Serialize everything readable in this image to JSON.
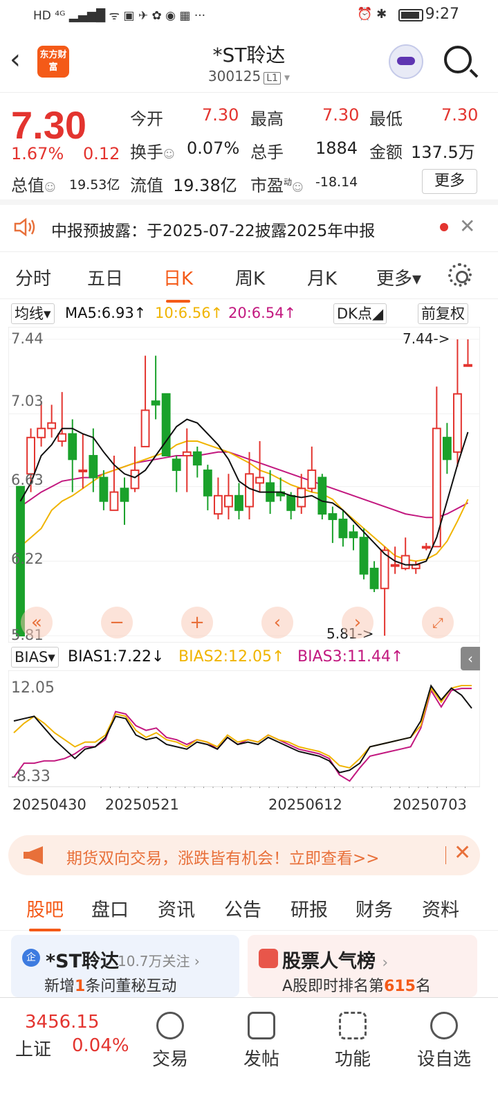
{
  "status_bar": {
    "time": "9:27",
    "left_icons": "HD ⁴ᴳ ▂▄▆█ ᯤ ▣ ✈ ✿ ◉ ▦ ···",
    "right_icons": "⏰ ✱"
  },
  "header": {
    "title": "*ST聆达",
    "code": "300125",
    "level": "L1",
    "logo_text": "东方财富"
  },
  "quote": {
    "price": "7.30",
    "change_pct": "1.67%",
    "change": "0.12",
    "open_label": "今开",
    "open": "7.30",
    "high_label": "最高",
    "high": "7.30",
    "low_label": "最低",
    "low": "7.30",
    "turnover_label": "换手",
    "turnover": "0.07%",
    "volume_label": "总手",
    "volume": "1884",
    "amount_label": "金额",
    "amount": "137.5万",
    "mktcap_label": "总值",
    "mktcap": "19.53亿",
    "float_label": "流值",
    "float": "19.38亿",
    "pe_label": "市盈",
    "pe_sup": "动",
    "pe": "-18.14",
    "more": "更多"
  },
  "notice": {
    "text": "中报预披露：于2025-07-22披露2025年中报"
  },
  "period_tabs": [
    "分时",
    "五日",
    "日K",
    "周K",
    "月K",
    "更多▾"
  ],
  "ma_bar": {
    "selector": "均线▾",
    "ma5": "MA5:6.93↑",
    "ma10": "10:6.56↑",
    "ma20": "20:6.54↑",
    "dk": "DK点◢",
    "fq": "前复权"
  },
  "chart_labels": {
    "y_ticks": [
      "7.44",
      "7.03",
      "6.63",
      "6.22",
      "5.81"
    ],
    "max_note": "7.44->",
    "min_note": "5.81->"
  },
  "bias_bar": {
    "selector": "BIAS▾",
    "b1": "BIAS1:7.22↓",
    "b2": "BIAS2:12.05↑",
    "b3": "BIAS3:11.44↑",
    "top": "12.05",
    "bottom": "-8.33"
  },
  "dates": [
    "20250430",
    "20250521",
    "20250612",
    "20250703"
  ],
  "ad": {
    "text": "期货双向交易，涨跌皆有机会！立即查看>>"
  },
  "bottom_tabs": [
    "股吧",
    "盘口",
    "资讯",
    "公告",
    "研报",
    "财务",
    "资料"
  ],
  "card_left": {
    "badge": "企",
    "title": "*ST聆达",
    "followers": "10.7万关注",
    "sub_pre": "新增",
    "sub_num": "1",
    "sub_post": "条问董秘互动"
  },
  "card_right": {
    "title": "股票人气榜",
    "sub_pre": "A股即时排名第",
    "sub_num": "615",
    "sub_post": "名"
  },
  "bottom_nav": {
    "index_value": "3456.15",
    "index_name": "上证",
    "index_pct": "0.04%",
    "trade": "交易",
    "post": "发帖",
    "func": "功能",
    "watch": "设自选"
  },
  "colors": {
    "up": "#e3342f",
    "down": "#1aa12b",
    "accent": "#f45a18",
    "ma5": "#111111",
    "ma10": "#f0b400",
    "ma20": "#c2187f"
  },
  "chart_data": {
    "type": "candlestick",
    "y_range": [
      5.81,
      7.44
    ],
    "candles": [
      [
        6.63,
        5.81,
        6.63,
        5.81
      ],
      [
        6.7,
        6.9,
        6.95,
        6.6
      ],
      [
        6.9,
        6.95,
        7.1,
        6.85
      ],
      [
        6.95,
        6.98,
        7.08,
        6.9
      ],
      [
        6.88,
        6.92,
        7.15,
        6.85
      ],
      [
        6.92,
        6.78,
        7.0,
        6.6
      ],
      [
        6.72,
        6.72,
        6.92,
        6.62
      ],
      [
        6.8,
        6.68,
        6.95,
        6.6
      ],
      [
        6.68,
        6.55,
        6.72,
        6.5
      ],
      [
        6.5,
        6.6,
        6.8,
        6.5
      ],
      [
        6.62,
        6.55,
        6.68,
        6.42
      ],
      [
        6.62,
        6.72,
        6.85,
        6.6
      ],
      [
        6.85,
        7.05,
        7.35,
        6.85
      ],
      [
        7.1,
        7.08,
        7.35,
        7.0
      ],
      [
        7.14,
        6.8,
        7.14,
        6.8
      ],
      [
        6.78,
        6.72,
        6.8,
        6.6
      ],
      [
        6.8,
        6.82,
        6.95,
        6.6
      ],
      [
        6.82,
        6.75,
        6.85,
        6.68
      ],
      [
        6.72,
        6.58,
        6.75,
        6.5
      ],
      [
        6.48,
        6.58,
        6.68,
        6.45
      ],
      [
        6.52,
        6.58,
        6.7,
        6.45
      ],
      [
        6.58,
        6.5,
        6.65,
        6.45
      ],
      [
        6.52,
        6.7,
        6.82,
        6.45
      ],
      [
        6.65,
        6.68,
        6.88,
        6.6
      ],
      [
        6.65,
        6.55,
        6.72,
        6.48
      ],
      [
        6.6,
        6.58,
        6.68,
        6.55
      ],
      [
        6.58,
        6.5,
        6.6,
        6.45
      ],
      [
        6.52,
        6.62,
        6.7,
        6.48
      ],
      [
        6.62,
        6.72,
        6.85,
        6.6
      ],
      [
        6.68,
        6.48,
        6.7,
        6.45
      ],
      [
        6.48,
        6.45,
        6.52,
        6.32
      ],
      [
        6.45,
        6.35,
        6.5,
        6.3
      ],
      [
        6.38,
        6.35,
        6.42,
        6.28
      ],
      [
        6.35,
        6.15,
        6.4,
        6.12
      ],
      [
        6.18,
        6.07,
        6.22,
        6.05
      ],
      [
        6.07,
        6.28,
        6.3,
        5.81
      ],
      [
        6.2,
        6.2,
        6.3,
        6.15
      ],
      [
        6.18,
        6.25,
        6.35,
        6.17
      ],
      [
        6.18,
        6.2,
        6.22,
        6.15
      ],
      [
        6.3,
        6.3,
        6.32,
        6.28
      ],
      [
        6.3,
        6.95,
        7.18,
        6.3
      ],
      [
        6.9,
        6.78,
        6.98,
        6.7
      ],
      [
        6.82,
        7.14,
        7.44,
        6.74
      ],
      [
        7.3,
        7.3,
        7.44,
        7.3
      ]
    ],
    "ma5": [
      6.55,
      6.65,
      6.8,
      6.86,
      6.95,
      6.95,
      6.92,
      6.9,
      6.82,
      6.75,
      6.7,
      6.68,
      6.72,
      6.8,
      6.88,
      6.96,
      7.0,
      6.98,
      6.92,
      6.86,
      6.78,
      6.66,
      6.62,
      6.6,
      6.6,
      6.6,
      6.58,
      6.57,
      6.58,
      6.55,
      6.54,
      6.5,
      6.44,
      6.38,
      6.32,
      6.26,
      6.22,
      6.2,
      6.2,
      6.22,
      6.35,
      6.55,
      6.75,
      6.93
    ],
    "ma10": [
      6.3,
      6.35,
      6.4,
      6.5,
      6.55,
      6.58,
      6.62,
      6.66,
      6.7,
      6.72,
      6.74,
      6.76,
      6.78,
      6.8,
      6.82,
      6.86,
      6.88,
      6.88,
      6.86,
      6.84,
      6.82,
      6.79,
      6.76,
      6.72,
      6.7,
      6.67,
      6.64,
      6.62,
      6.6,
      6.59,
      6.56,
      6.5,
      6.45,
      6.4,
      6.35,
      6.3,
      6.25,
      6.23,
      6.22,
      6.23,
      6.26,
      6.33,
      6.44,
      6.56
    ],
    "ma20": [
      6.52,
      6.56,
      6.6,
      6.63,
      6.66,
      6.67,
      6.68,
      6.68,
      6.7,
      6.72,
      6.74,
      6.76,
      6.77,
      6.78,
      6.79,
      6.8,
      6.8,
      6.8,
      6.81,
      6.82,
      6.82,
      6.8,
      6.78,
      6.76,
      6.74,
      6.72,
      6.7,
      6.68,
      6.66,
      6.64,
      6.62,
      6.6,
      6.58,
      6.56,
      6.54,
      6.52,
      6.5,
      6.48,
      6.47,
      6.46,
      6.46,
      6.48,
      6.51,
      6.54
    ],
    "bias_range": [
      -8.33,
      12.05
    ],
    "bias1": [
      4.5,
      5.0,
      5.5,
      3.0,
      0.5,
      -1.5,
      -3.5,
      -1.5,
      -1.0,
      1.0,
      5.5,
      5.0,
      1.5,
      0.5,
      1.0,
      -0.5,
      -1.0,
      -1.5,
      0.0,
      -0.5,
      -1.5,
      1.0,
      -0.5,
      0.0,
      -0.5,
      1.0,
      0.0,
      -1.0,
      -2.0,
      -2.5,
      -3.0,
      -4.0,
      -6.5,
      -6.0,
      -4.5,
      -1.0,
      -0.5,
      0.0,
      0.5,
      1.0,
      4.5,
      12.0,
      9.0,
      11.5,
      10.0,
      7.22
    ],
    "bias2": [
      2.0,
      4.0,
      5.5,
      4.0,
      2.0,
      0.5,
      -1.0,
      0.0,
      0.0,
      1.5,
      6.0,
      5.5,
      2.5,
      1.0,
      2.0,
      0.5,
      0.0,
      -1.0,
      0.5,
      0.0,
      -1.0,
      1.5,
      0.0,
      0.5,
      0.0,
      1.5,
      0.5,
      0.0,
      -1.0,
      -1.5,
      -2.0,
      -3.0,
      -5.0,
      -5.5,
      -3.5,
      -1.0,
      -0.5,
      0.0,
      0.5,
      1.0,
      3.5,
      11.5,
      8.5,
      11.5,
      12.05,
      12.05
    ],
    "bias3": [
      -7.5,
      -4.5,
      -4.5,
      -4.0,
      -4.0,
      -3.5,
      -2.5,
      -1.0,
      -1.0,
      0.5,
      6.5,
      6.0,
      3.5,
      2.5,
      3.0,
      1.0,
      0.5,
      -0.5,
      0.5,
      0.0,
      -1.5,
      1.0,
      -0.5,
      0.5,
      0.0,
      1.5,
      0.5,
      -0.5,
      -1.5,
      -2.0,
      -2.5,
      -3.5,
      -7.0,
      -8.3,
      -5.5,
      -3.0,
      -2.5,
      -2.0,
      -1.5,
      -1.0,
      3.0,
      11.0,
      7.5,
      11.0,
      11.44,
      11.44
    ]
  }
}
